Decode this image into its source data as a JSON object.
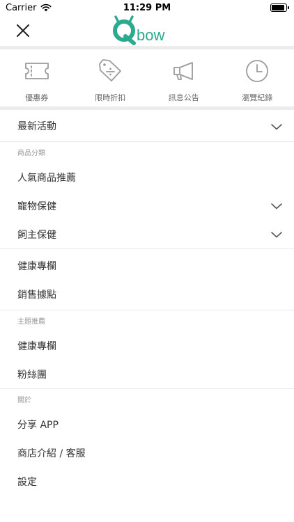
{
  "status": {
    "carrier": "Carrier",
    "time": "11:29 PM",
    "battery_level": 0.9
  },
  "header": {
    "logo_text": "bow"
  },
  "quick_actions": [
    {
      "label": "優惠券",
      "icon": "ticket-icon"
    },
    {
      "label": "限時折扣",
      "icon": "price-tag-icon"
    },
    {
      "label": "訊息公告",
      "icon": "megaphone-icon"
    },
    {
      "label": "瀏覽紀錄",
      "icon": "clock-icon"
    }
  ],
  "menu": {
    "latest": "最新活動",
    "category_header": "商品分類",
    "popular": "人氣商品推薦",
    "pet_health": "寵物保健",
    "owner_health": "飼主保健",
    "health_column": "健康專欄",
    "sales_points": "銷售據點",
    "theme_header": "主題推薦",
    "theme_health_column": "健康專欄",
    "fan_club": "粉絲團",
    "about_header": "關於",
    "share_app": "分享 APP",
    "store_intro": "商店介紹 / 客服",
    "settings": "設定"
  },
  "colors": {
    "brand": "#2BAA8F",
    "icon_gray": "#9a9a9a"
  }
}
